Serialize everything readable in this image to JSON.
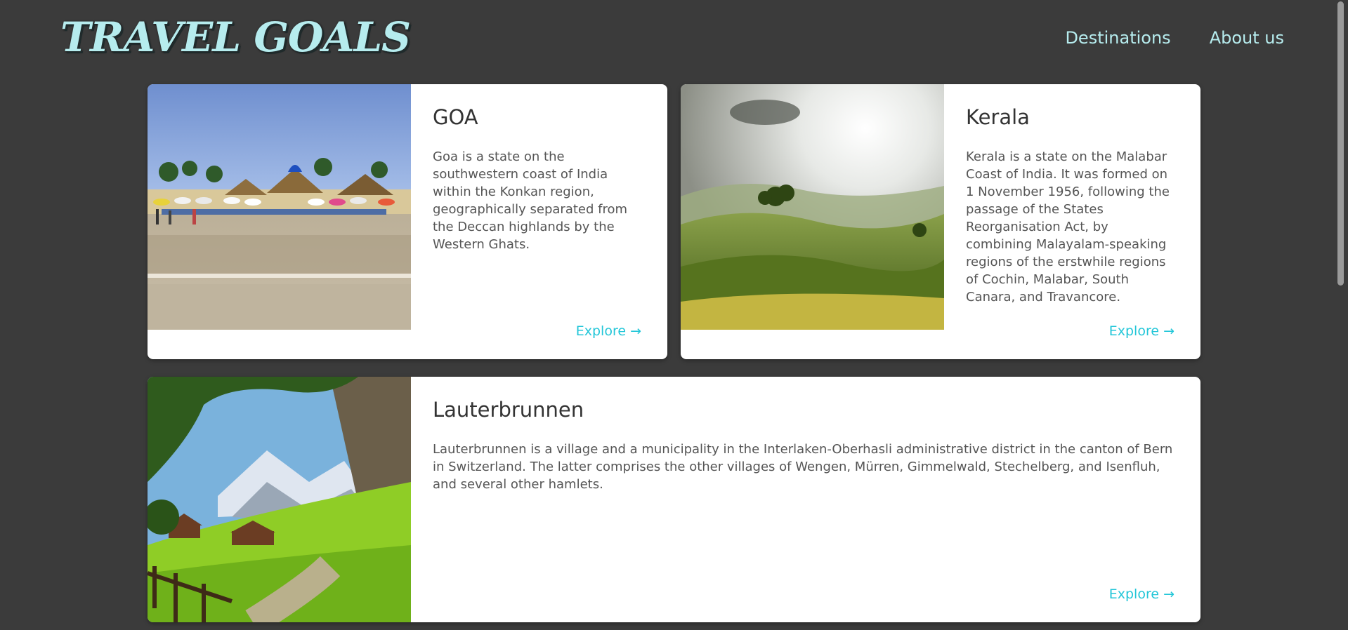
{
  "header": {
    "logo": "TRAVEL GOALS",
    "nav": [
      {
        "label": "Destinations"
      },
      {
        "label": "About us"
      }
    ]
  },
  "cards": [
    {
      "title": "GOA",
      "description": "Goa is a state on the southwestern coast of India within the Konkan region, geographically separated from the Deccan highlands by the Western Ghats.",
      "explore": "Explore →",
      "image": "beach-photo"
    },
    {
      "title": "Kerala",
      "description": "Kerala is a state on the Malabar Coast of India. It was formed on 1 November 1956, following the passage of the States Reorganisation Act, by combining Malayalam-speaking regions of the erstwhile regions of Cochin, Malabar, South Canara, and Travancore.",
      "explore": "Explore →",
      "image": "tea-hills-photo"
    },
    {
      "title": "Lauterbrunnen",
      "description": "Lauterbrunnen is a village and a municipality in the Interlaken-Oberhasli administrative district in the canton of Bern in Switzerland. The latter comprises the other villages of Wengen, Mürren, Gimmelwald, Stechelberg, and Isenfluh, and several other hamlets.",
      "explore": "Explore →",
      "image": "alpine-valley-photo"
    }
  ],
  "colors": {
    "background": "#3b3b3b",
    "accent": "#22c6d8",
    "logo": "#b6ecee"
  }
}
